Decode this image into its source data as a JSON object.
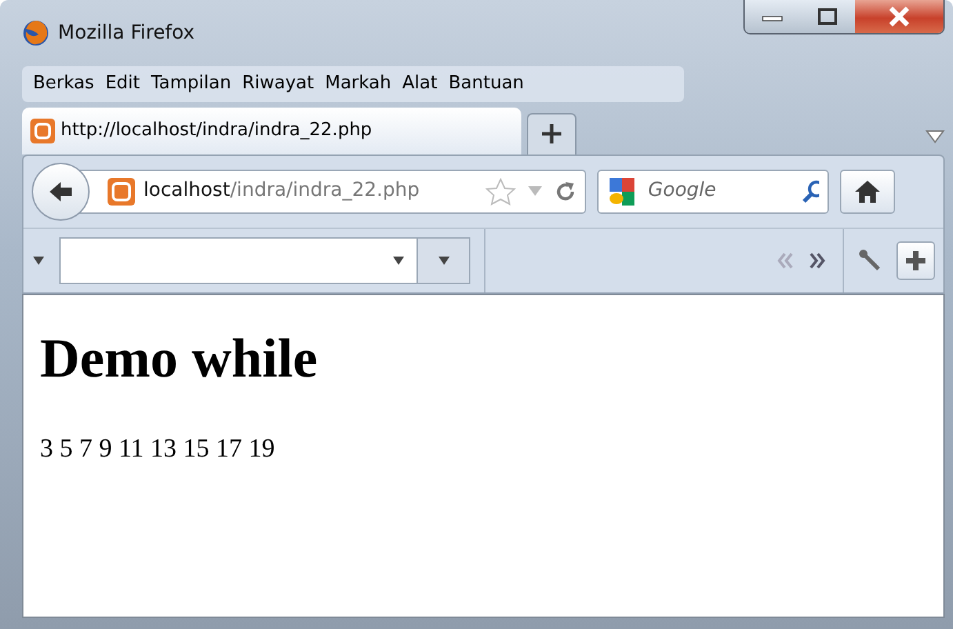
{
  "window": {
    "title": "Mozilla Firefox"
  },
  "menu": [
    "Berkas",
    "Edit",
    "Tampilan",
    "Riwayat",
    "Markah",
    "Alat",
    "Bantuan"
  ],
  "tabs": [
    {
      "label": "http://localhost/indra/indra_22.php",
      "selected": true
    }
  ],
  "address": {
    "host": "localhost",
    "path": "/indra/indra_22.php"
  },
  "search": {
    "placeholder": "Google"
  },
  "page": {
    "heading": "Demo while",
    "text": "3 5 7 9 11 13 15 17 19"
  }
}
